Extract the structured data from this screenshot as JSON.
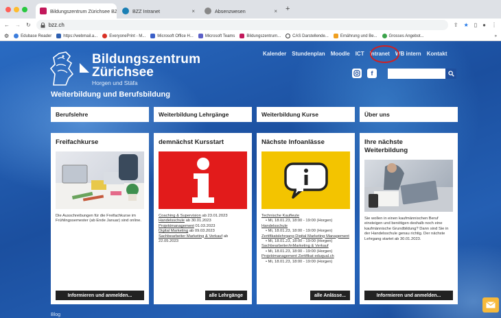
{
  "browser": {
    "tabs": [
      {
        "title": "Bildungszentrum Zürichsee BZ",
        "color": "#c2185b"
      },
      {
        "title": "BZZ Intranet",
        "color": "#1a7fb4"
      },
      {
        "title": "Absenzwesen",
        "color": "#666666"
      }
    ],
    "close_glyph": "×",
    "new_tab_glyph": "+",
    "url": "bzz.ch",
    "bookmarks": [
      {
        "label": "Edubase Reader",
        "color": "#3b7ddd"
      },
      {
        "label": "https://webmail.a...",
        "color": "#2d5fb0"
      },
      {
        "label": "EveryonePrint - M...",
        "color": "#d93025"
      },
      {
        "label": "Microsoft Office H...",
        "color": "#3a5fc8"
      },
      {
        "label": "Microsoft Teams",
        "color": "#5b5fc7"
      },
      {
        "label": "Bildungszentrum...",
        "color": "#c2185b"
      },
      {
        "label": "CAS Darstellende...",
        "color": "#333333"
      },
      {
        "label": "Ernährung und Be...",
        "color": "#f0a020"
      },
      {
        "label": "Grosses Angebot...",
        "color": "#3aa34a"
      }
    ],
    "more_glyph": "»"
  },
  "site": {
    "brand_line1": "Bildungszentrum",
    "brand_line2": "Zürichsee",
    "brand_line3": "Horgen und Stäfa",
    "tagline": "Weiterbildung und Berufsbildung",
    "nav": [
      "Kalender",
      "Stundenplan",
      "Moodle",
      "ICT",
      "Intranet",
      "WB intern",
      "Kontakt"
    ],
    "social": [
      "instagram-icon",
      "facebook-icon"
    ],
    "search_placeholder": ""
  },
  "categories": [
    "Berufslehre",
    "Weiterbildung Lehrgänge",
    "Weiterbildung Kurse",
    "Über uns"
  ],
  "cards": [
    {
      "title": "Freifachkurse",
      "text": "Die Ausschreibungen für die Freifachkurse im Frühlingssemester (ab Ende Januar) sind online.",
      "button": "Informieren und anmelden..."
    },
    {
      "title": "demnächst Kursstart",
      "lines": [
        {
          "link": "Coaching & Supervision",
          "rest": " ab 23.01.2023"
        },
        {
          "link": "Handelsschule",
          "rest": " ab 30.01.2023"
        },
        {
          "link": "Projektmanagement",
          "rest": " 01.03.2023"
        },
        {
          "link": "Digital Marketing",
          "rest": " ab 09.03.2023"
        },
        {
          "link": "Sachbearbeiter Marketing & Verkauf",
          "rest": " ab 22.05.2023"
        }
      ],
      "button": "alle Lehrgänge"
    },
    {
      "title": "Nächste Infoanlässe",
      "lines": [
        {
          "link": "Technische Kaufleute"
        },
        {
          "item": "• Mi, 18.01.23, 18:00 - 19:00 (Horgen)"
        },
        {
          "link": "Handelsschule"
        },
        {
          "item": "• Mi, 18.01.23, 18:00 - 19:00 (Horgen)"
        },
        {
          "link": "Zertifikatslehrgang Digital Marketing Management"
        },
        {
          "item": "• Mi, 18.01.23, 18:00 - 19:00 (Horgen)"
        },
        {
          "link": "Sachbearbeiter/inMarketing & Verkauf"
        },
        {
          "item": "• Mi, 18.01.23, 18:00 - 19:00 (Horgen)"
        },
        {
          "link": "Projektmanagement Zertifikat eduqual.ch"
        },
        {
          "item": "• Mi, 18.01.23, 18:00 - 19:00 (Horgen)"
        }
      ],
      "button": "alle Anlässe..."
    },
    {
      "title": "Ihre nächste Weiterbildung",
      "text": "Sie wollen in einen kaufmännischen Beruf einsteigen und benötigen deshalb noch eine kaufmännische Grundbildung? Dann sind Sie in der Handelsschule genau richtig. Der nächste Lehrgang startet ab 30.01.2023.",
      "button": "Informieren und anmelden..."
    }
  ],
  "footer_partial": "Blog",
  "colors": {
    "brand_blue": "#1f4f9e",
    "highlight_red": "#d21f1f",
    "info_red": "#e21b1b",
    "info_yellow": "#f3c400",
    "mail_orange": "#f6b93b"
  }
}
